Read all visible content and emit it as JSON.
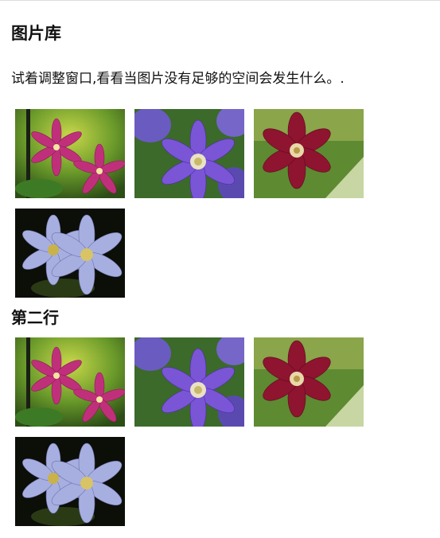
{
  "page": {
    "title": "图片库",
    "intro": "试着调整窗口,看看当图片没有足够的空间会发生什么。.",
    "second_row_title": "第二行"
  },
  "galleries": [
    {
      "images": [
        {
          "subject": "pink clematis flowers"
        },
        {
          "subject": "purple clematis flower"
        },
        {
          "subject": "dark red clematis flower"
        },
        {
          "subject": "pale lavender clematis flowers"
        }
      ]
    },
    {
      "images": [
        {
          "subject": "pink clematis flowers"
        },
        {
          "subject": "purple clematis flower"
        },
        {
          "subject": "dark red clematis flower"
        },
        {
          "subject": "pale lavender clematis flowers"
        }
      ]
    }
  ],
  "colors": {
    "text": "#111111",
    "background": "#ffffff",
    "pink_flower": "#c0307a",
    "purple_flower": "#7a55d6",
    "red_flower": "#8e1430",
    "lavender_flower": "#a7aee0"
  }
}
